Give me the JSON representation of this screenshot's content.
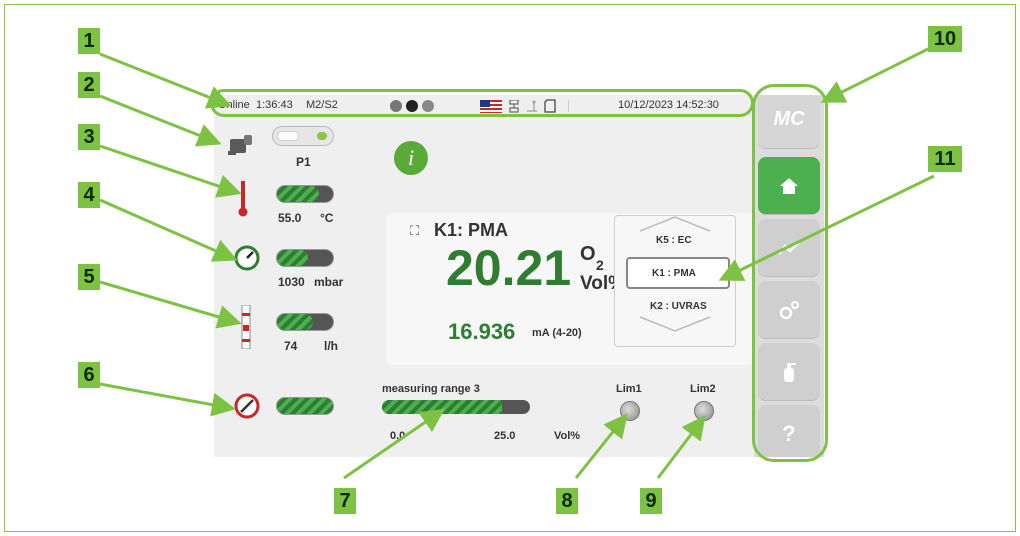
{
  "status": {
    "state": "Online",
    "runtime": "1:36:43",
    "mode": "M2/S2",
    "datetime": "10/12/2023 14:52:30"
  },
  "left": {
    "pump_label": "P1",
    "temperature": {
      "value": "55.0",
      "unit": "°C",
      "level": 0.75
    },
    "pressure": {
      "value": "1030",
      "unit": "mbar",
      "level": 0.55
    },
    "flow": {
      "value": "74",
      "unit": "l/h",
      "level": 0.65
    },
    "filter": {
      "level": 1.0
    }
  },
  "main": {
    "channel": "K1: PMA",
    "value": "20.21",
    "component": "O",
    "component_sub": "2",
    "unit": "Vol%",
    "current_value": "16.936",
    "current_unit": "mA (4-20)",
    "range_title": "measuring range 3",
    "range_min": "0.0",
    "range_max": "25.0",
    "range_unit": "Vol%",
    "range_fill": 0.81,
    "lim1": "Lim1",
    "lim2": "Lim2"
  },
  "channels": {
    "prev": "K5 : EC",
    "current": "K1 : PMA",
    "next": "K2 : UVRAS"
  },
  "sidebar": {
    "logo": "MC"
  },
  "callouts": [
    "1",
    "2",
    "3",
    "4",
    "5",
    "6",
    "7",
    "8",
    "9",
    "10",
    "11"
  ],
  "colors": {
    "accent": "#4caf50",
    "value_green": "#2e7d32",
    "callout": "#7dc242"
  }
}
